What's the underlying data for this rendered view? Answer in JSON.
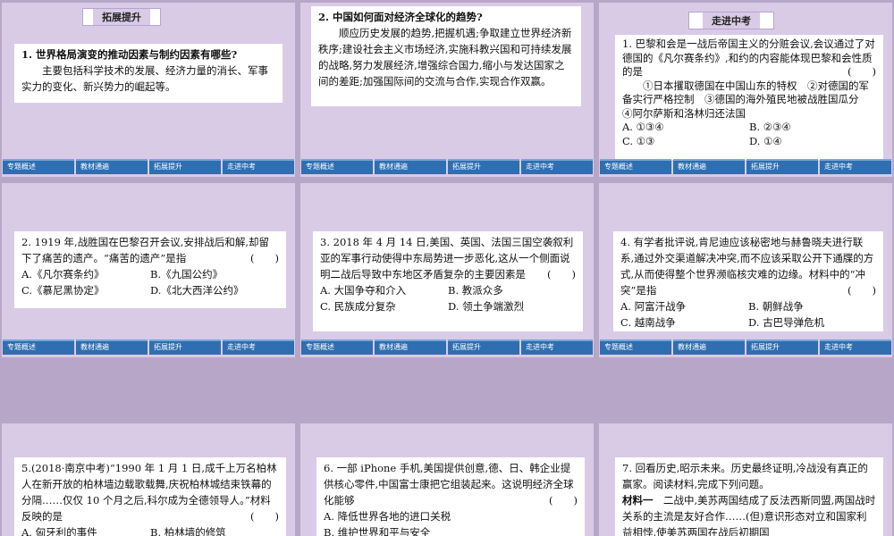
{
  "nav_labels": [
    "专题概述",
    "教材通遍",
    "拓展提升",
    "走进中考"
  ],
  "slide1": {
    "banner": "拓展提升",
    "question": "1. 世界格局演变的推动因素与制约因素有哪些?",
    "answer": "主要包括科学技术的发展、经济力量的消长、军事实力的变化、新兴势力的崛起等。"
  },
  "slide2": {
    "question": "2. 中国如何面对经济全球化的趋势?",
    "answer": "顺应历史发展的趋势,把握机遇;争取建立世界经济新秩序;建设社会主义市场经济,实施科教兴国和可持续发展的战略,努力发展经济,增强综合国力,缩小与发达国家之间的差距;加强国际间的交流与合作,实现合作双赢。"
  },
  "slide3": {
    "banner": "走进中考",
    "stem": "1. 巴黎和会是一战后帝国主义的分赃会议,会议通过了对德国的《凡尔赛条约》,和约的内容能体现巴黎和会性质的是",
    "paren": "(　　)",
    "items": "①日本攫取德国在中国山东的特权　②对德国的军备实行严格控制　③德国的海外殖民地被战胜国瓜分　④阿尔萨斯和洛林归还法国",
    "opt_a": "A. ①③④",
    "opt_b": "B. ②③④",
    "opt_c": "C. ①③",
    "opt_d": "D. ①④"
  },
  "slide4": {
    "stem": "2. 1919 年,战胜国在巴黎召开会议,安排战后和解,却留下了痛苦的遗产。“痛苦的遗产”是指",
    "paren": "(　　)",
    "opt_a": "A.《凡尔赛条约》",
    "opt_b": "B.《九国公约》",
    "opt_c": "C.《慕尼黑协定》",
    "opt_d": "D.《北大西洋公约》"
  },
  "slide5": {
    "stem": "3. 2018 年 4 月 14 日,美国、英国、法国三国空袭叙利亚的军事行动使得中东局势进一步恶化,这从一个侧面说明二战后导致中东地区矛盾复杂的主要因素是",
    "paren": "(　　)",
    "opt_a": "A. 大国争夺和介入",
    "opt_b": "B. 教派众多",
    "opt_c": "C. 民族成分复杂",
    "opt_d": "D. 领土争端激烈"
  },
  "slide6": {
    "stem": "4. 有学者批评说,肯尼迪应该秘密地与赫鲁晓夫进行联系,通过外交渠道解决冲突,而不应该采取公开下通牒的方式,从而使得整个世界濒临核灾难的边缘。材料中的“冲突”是指",
    "paren": "(　　)",
    "opt_a": "A. 阿富汗战争",
    "opt_b": "B. 朝鲜战争",
    "opt_c": "C. 越南战争",
    "opt_d": "D. 古巴导弹危机"
  },
  "slide7": {
    "stem": "5.(2018·南京中考)“1990 年 1 月 1 日,成千上万名柏林人在新开放的柏林墙边载歌载舞,庆祝柏林城结束铁幕的分隔……仅仅 10 个月之后,科尔成为全德领导人。”材料反映的是",
    "paren": "(　　)",
    "opt_a": "A. 匈牙利的事件",
    "opt_b": "B. 柏林墙的修筑"
  },
  "slide8": {
    "stem": "6. 一部 iPhone 手机,美国提供创意,德、日、韩企业提供核心零件,中国富士康把它组装起来。这说明经济全球化能够",
    "paren": "(　　)",
    "opt_a": "A. 降低世界各地的进口关税",
    "opt_b": "B. 维护世界和平与安全"
  },
  "slide9": {
    "stem": "7. 回看历史,昭示未来。历史最终证明,冷战没有真正的赢家。阅读材料,完成下列问题。",
    "material_label": "材料一",
    "material": "二战中,美苏两国结成了反法西斯同盟,两国战时关系的主流是友好合作……(但)意识形态对立和国家利益相悖,使美苏两国在战后初期国"
  }
}
